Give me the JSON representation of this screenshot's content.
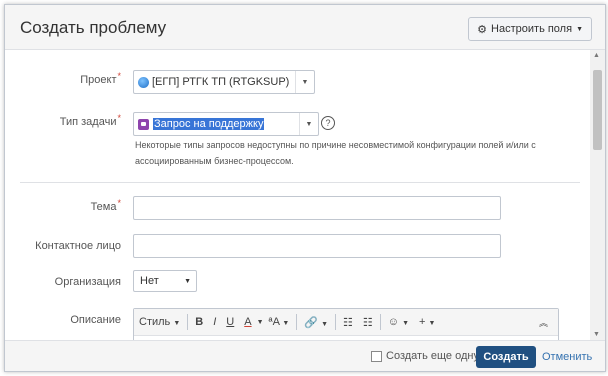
{
  "dialog": {
    "title": "Создать проблему",
    "config_button": "Настроить поля"
  },
  "form": {
    "project": {
      "label": "Проект",
      "value": "[ЕГП] РТГК ТП (RTGKSUP)"
    },
    "issue_type": {
      "label": "Тип задачи",
      "value": "Запрос на поддержку",
      "note": "Некоторые типы запросов недоступны по причине несовместимой конфигурации полей и/или с ассоциированным бизнес-процессом."
    },
    "summary": {
      "label": "Тема",
      "value": ""
    },
    "contact": {
      "label": "Контактное лицо",
      "value": ""
    },
    "organization": {
      "label": "Организация",
      "value": "Нет"
    },
    "description": {
      "label": "Описание"
    }
  },
  "editor_toolbar": {
    "style": "Стиль",
    "bold": "B",
    "italic": "I",
    "underline": "U",
    "color": "A",
    "more_format": "ªA",
    "bullet": "☷",
    "numbered": "☷",
    "emoji": "☺",
    "insert": "+"
  },
  "footer": {
    "create_another": "Создать еще одну",
    "create": "Создать",
    "cancel": "Отменить"
  },
  "colors": {
    "primary": "#205081",
    "link": "#3572b0",
    "required": "#d04437",
    "selection": "#3875d7"
  }
}
